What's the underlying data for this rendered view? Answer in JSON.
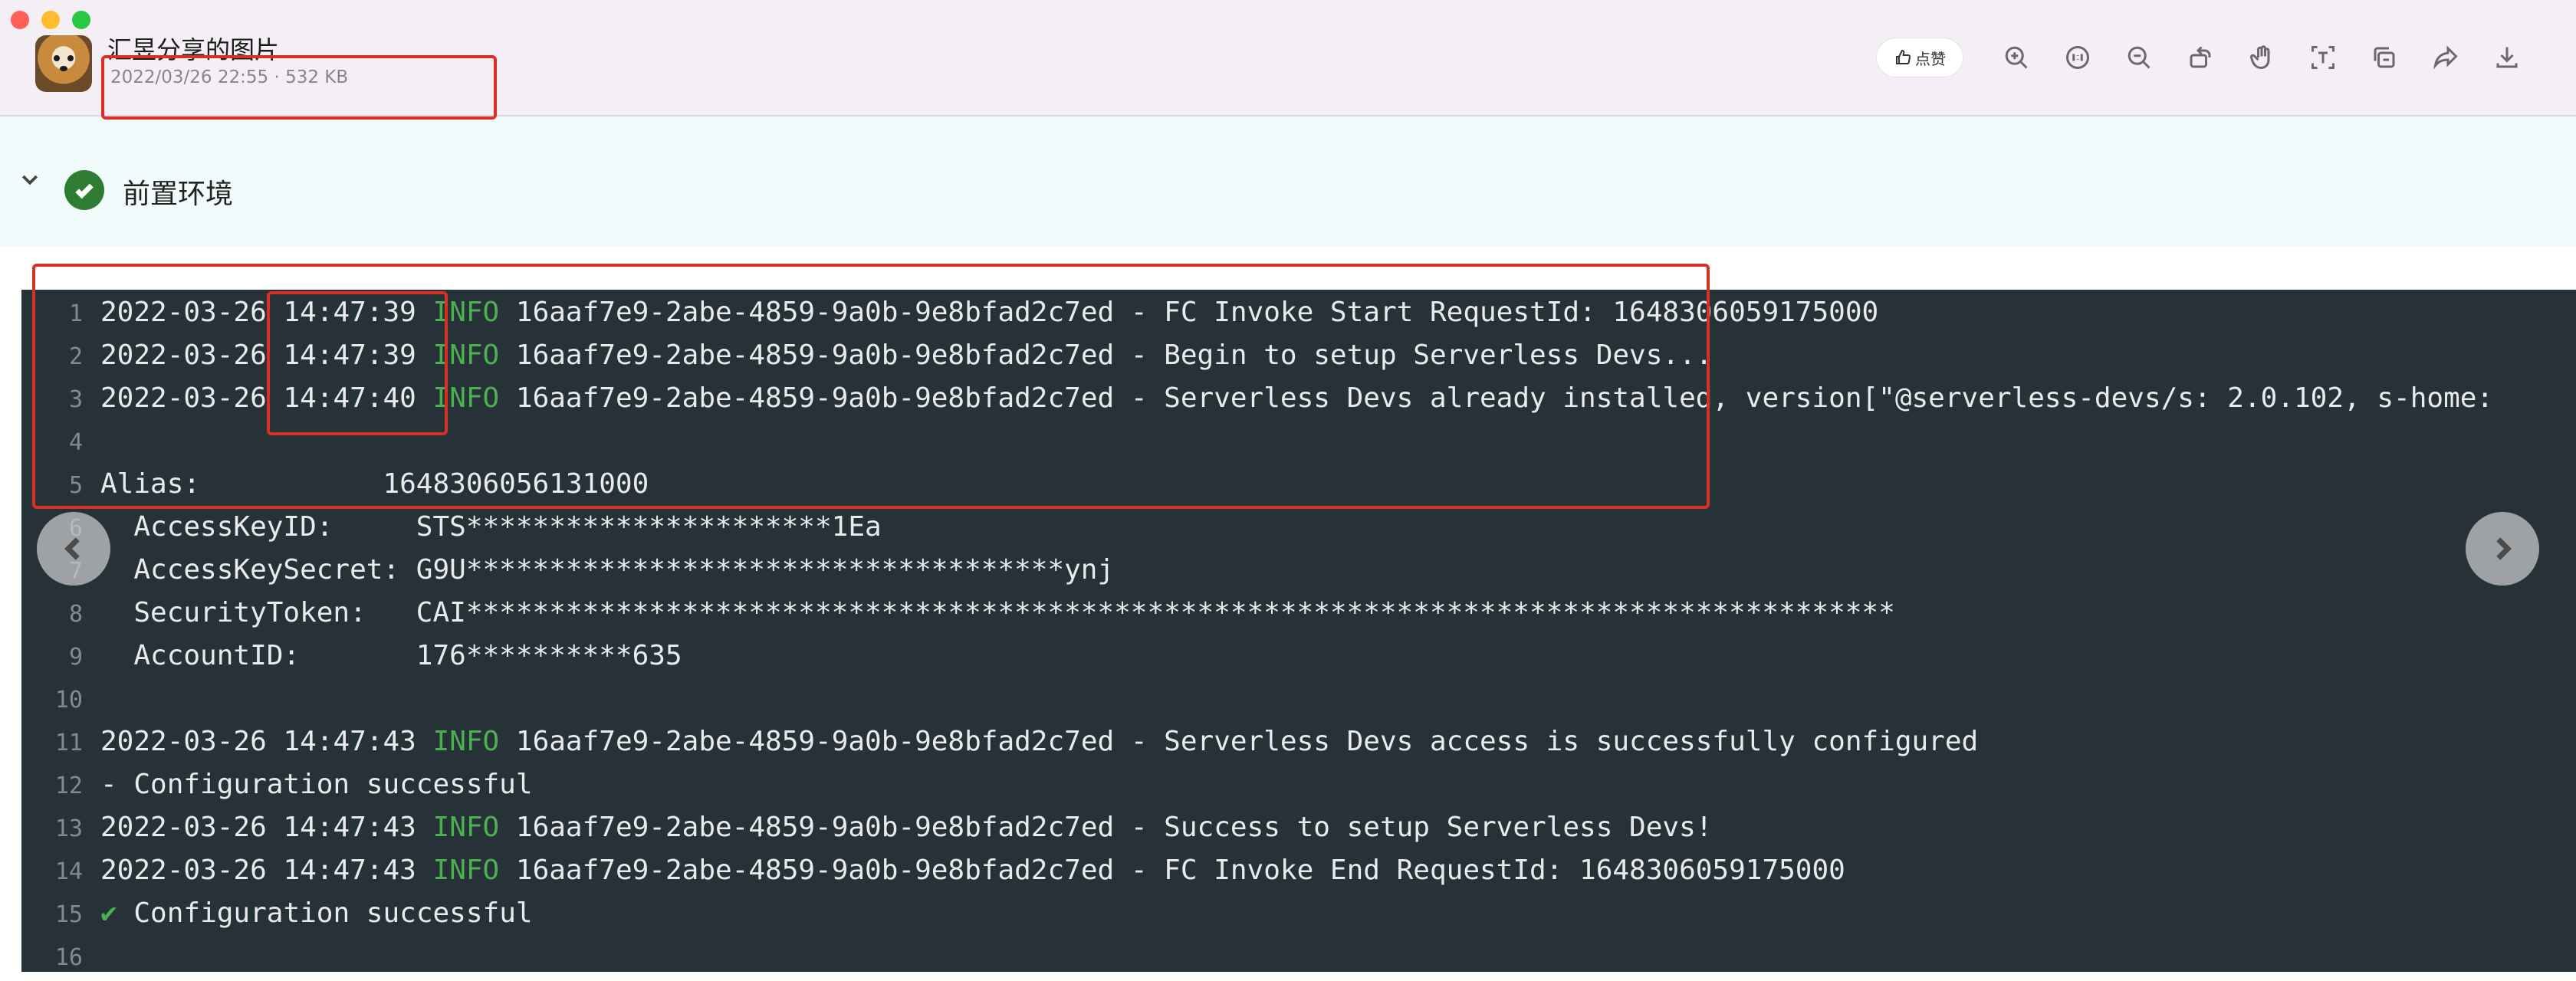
{
  "window": {
    "title": "汇昱分享的图片",
    "file_meta": "2022/03/26 22:55 · 532 KB"
  },
  "toolbar": {
    "like_label": "点赞",
    "tools": [
      "zoom-in-icon",
      "fit-size-icon",
      "zoom-out-icon",
      "rotate-icon",
      "hand-icon",
      "text-recognize-icon",
      "copy-icon",
      "share-icon",
      "download-icon"
    ]
  },
  "section": {
    "title": "前置环境"
  },
  "terminal": {
    "lines": [
      {
        "n": "1",
        "date": "2022-03-26",
        "time": "14:47:39",
        "level": "INFO",
        "text": "16aaf7e9-2abe-4859-9a0b-9e8bfad2c7ed - FC Invoke Start RequestId: 1648306059175000"
      },
      {
        "n": "2",
        "date": "2022-03-26",
        "time": "14:47:39",
        "level": "INFO",
        "text": "16aaf7e9-2abe-4859-9a0b-9e8bfad2c7ed - Begin to setup Serverless Devs..."
      },
      {
        "n": "3",
        "date": "2022-03-26",
        "time": "14:47:40",
        "level": "INFO",
        "text": "16aaf7e9-2abe-4859-9a0b-9e8bfad2c7ed - Serverless Devs already installed, version[\"@serverless-devs/s: 2.0.102, s-home:"
      },
      {
        "n": "4",
        "text": ""
      },
      {
        "n": "5",
        "text": "Alias:           1648306056131000"
      },
      {
        "n": "6",
        "text": "  AccessKeyID:     STS**********************1Ea"
      },
      {
        "n": "7",
        "text": "  AccessKeySecret: G9U************************************ynj"
      },
      {
        "n": "8",
        "text": "  SecurityToken:   CAI**************************************************************************************"
      },
      {
        "n": "9",
        "text": "  AccountID:       176**********635"
      },
      {
        "n": "10",
        "text": ""
      },
      {
        "n": "11",
        "date": "2022-03-26",
        "time": "14:47:43",
        "level": "INFO",
        "text": "16aaf7e9-2abe-4859-9a0b-9e8bfad2c7ed - Serverless Devs access is successfully configured"
      },
      {
        "n": "12",
        "text": "- Configuration successful"
      },
      {
        "n": "13",
        "date": "2022-03-26",
        "time": "14:47:43",
        "level": "INFO",
        "text": "16aaf7e9-2abe-4859-9a0b-9e8bfad2c7ed - Success to setup Serverless Devs!"
      },
      {
        "n": "14",
        "date": "2022-03-26",
        "time": "14:47:43",
        "level": "INFO",
        "text": "16aaf7e9-2abe-4859-9a0b-9e8bfad2c7ed - FC Invoke End RequestId: 1648306059175000"
      },
      {
        "n": "15",
        "mark": "✔",
        "text": "Configuration successful"
      },
      {
        "n": "16",
        "text": ""
      }
    ]
  },
  "colors": {
    "terminal_bg": "#263238",
    "info": "#4caf50",
    "annotation": "#d93025",
    "success_badge": "#2e7d32"
  }
}
